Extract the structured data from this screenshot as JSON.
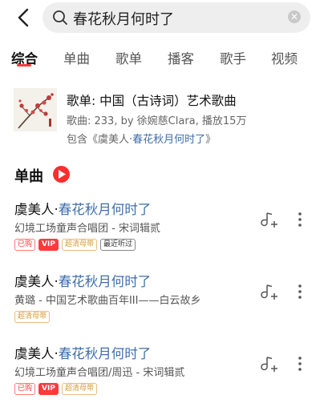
{
  "search": {
    "query": "春花秋月何时了",
    "clear_glyph": "✕"
  },
  "tabs": [
    "综合",
    "单曲",
    "歌单",
    "播客",
    "歌手",
    "视频"
  ],
  "active_tab": "综合",
  "playlist": {
    "title": "歌单: 中国（古诗词）艺术歌曲",
    "meta": "歌曲: 233, by 徐婉慈Clara, 播放15万",
    "contains_prefix": "包含《虞美人·",
    "contains_highlight": "春花秋月何时了",
    "contains_suffix": "》"
  },
  "section": {
    "title": "单曲"
  },
  "songs": [
    {
      "title_prefix": "虞美人·",
      "title_highlight": "春花秋月何时了",
      "subtitle": "幻境工场童声合唱团 - 宋词辑贰",
      "badges": [
        {
          "text": "已购",
          "style": "red"
        },
        {
          "text": "VIP",
          "style": "vip"
        },
        {
          "text": "超清母带",
          "style": "gold"
        },
        {
          "text": "最近听过",
          "style": "gray"
        }
      ]
    },
    {
      "title_prefix": "虞美人·",
      "title_highlight": "春花秋月何时了",
      "subtitle": "黄璐 - 中国艺术歌曲百年III——白云故乡",
      "badges": [
        {
          "text": "超清母带",
          "style": "gold"
        }
      ]
    },
    {
      "title_prefix": "虞美人·",
      "title_highlight": "春花秋月何时了",
      "subtitle": "幻境工场童声合唱团/周迅 - 宋词辑贰",
      "badges": [
        {
          "text": "已购",
          "style": "red"
        },
        {
          "text": "VIP",
          "style": "vip"
        },
        {
          "text": "超清母带",
          "style": "gold"
        }
      ]
    }
  ],
  "colors": {
    "accent": "#ff3a3a",
    "highlight": "#3e6ea8",
    "search_bg": "#eeeeee"
  },
  "icons": {
    "back": "chevron-left-icon",
    "search": "search-icon",
    "clear": "clear-icon",
    "play": "play-icon",
    "add": "add-to-playlist-icon",
    "more": "more-vertical-icon"
  }
}
